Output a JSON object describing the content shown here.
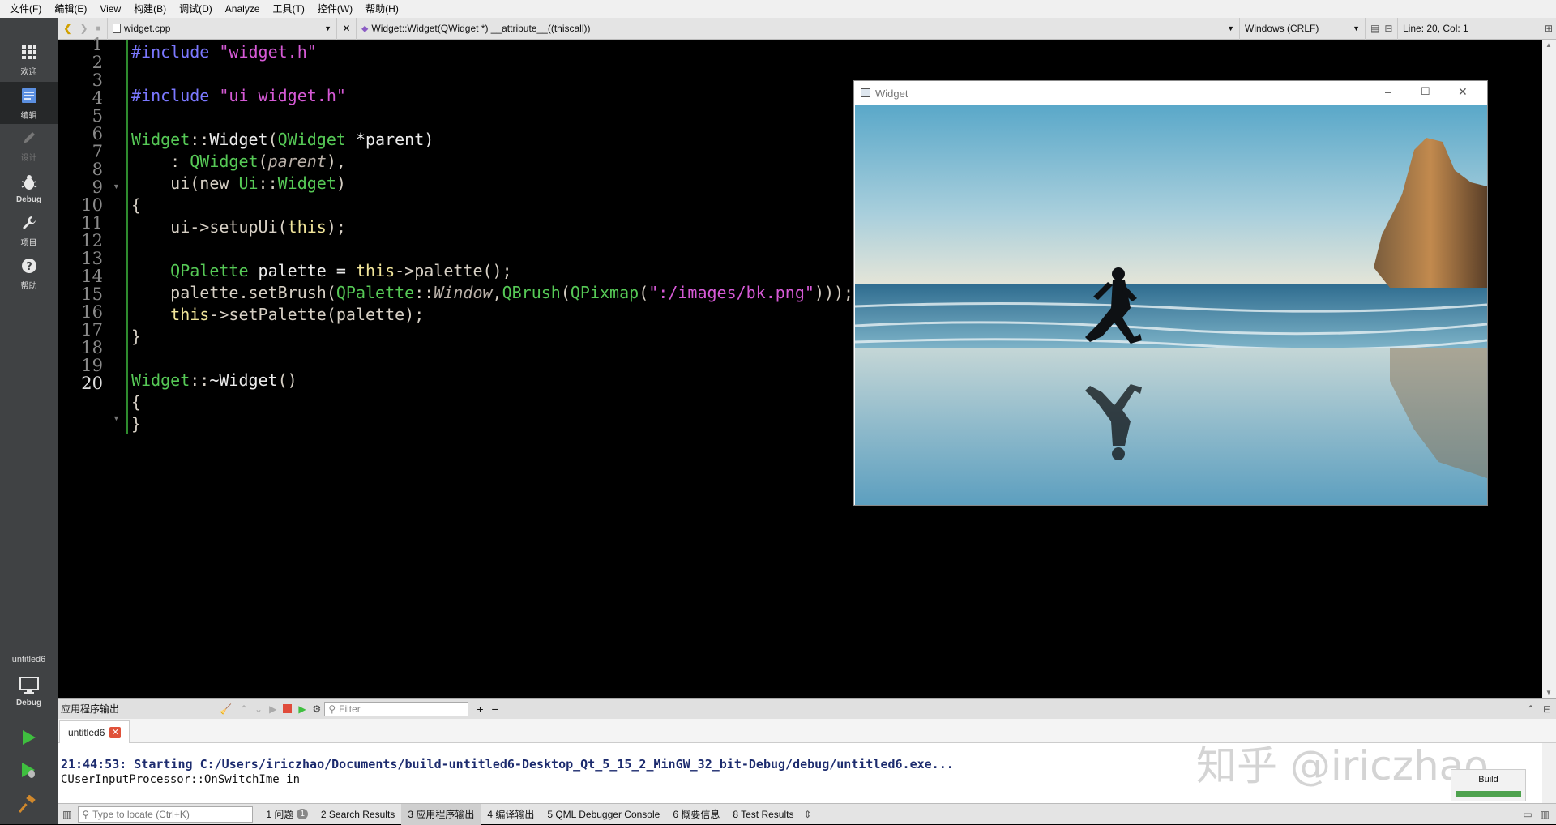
{
  "menu": [
    "文件(F)",
    "编辑(E)",
    "View",
    "构建(B)",
    "调试(D)",
    "Analyze",
    "工具(T)",
    "控件(W)",
    "帮助(H)"
  ],
  "modes": [
    {
      "label": "欢迎",
      "icon": "grid-icon"
    },
    {
      "label": "编辑",
      "icon": "edit-doc-icon"
    },
    {
      "label": "设计",
      "icon": "pencil-icon"
    },
    {
      "label": "Debug",
      "icon": "bug-icon"
    },
    {
      "label": "项目",
      "icon": "wrench-icon"
    },
    {
      "label": "帮助",
      "icon": "help-icon"
    }
  ],
  "kit": {
    "project": "untitled6",
    "config": "Debug"
  },
  "toolbar": {
    "file": "widget.cpp",
    "symbol": "Widget::Widget(QWidget *) __attribute__((thiscall))",
    "encoding": "Windows (CRLF)",
    "position": "Line: 20, Col: 1"
  },
  "line_numbers": [
    "1",
    "2",
    "3",
    "4",
    "5",
    "6",
    "7",
    "8",
    "9",
    "10",
    "11",
    "12",
    "13",
    "14",
    "15",
    "16",
    "17",
    "18",
    "19",
    "20"
  ],
  "current_line": "20",
  "code_tokens": [
    {
      "pp": "#include",
      "str": "\"widget.h\""
    },
    {
      "pp": "#include",
      "str": "\"ui_widget.h\""
    },
    {
      "cls": "Widget",
      "sep": "::",
      "fn": "Widget",
      "open": "(",
      "type": "QWidget",
      "rest": " *parent)"
    },
    {
      "pre": "    : ",
      "type": "QWidget",
      "open": "(",
      "it": "parent",
      "rest": "),"
    },
    {
      "pre": "    ui(new ",
      "ns": "Ui",
      "sep": "::",
      "type": "Widget",
      "rest": ")"
    },
    {
      "text": "{"
    },
    {
      "pre": "    ui->setupUi(",
      "kw": "this",
      "rest": ");"
    },
    {
      "pre": "    ",
      "type": "QPalette",
      "mid": " palette = ",
      "kw": "this",
      "rest": "->palette();"
    },
    {
      "pre": "    palette.setBrush(",
      "type": "QPalette",
      "sep": "::",
      "it": "Window",
      "comma": ",",
      "type2": "QBrush",
      "o2": "(",
      "type3": "QPixmap",
      "o3": "(",
      "str": "\":/images/bk.png\"",
      "rest": ")));"
    },
    {
      "pre": "    ",
      "kw": "this",
      "rest": "->setPalette(palette);"
    },
    {
      "text": "}"
    },
    {
      "cls": "Widget",
      "sep": "::",
      "fn": "~Widget",
      "rest": "()"
    },
    {
      "text": "{"
    },
    {
      "text": "}"
    }
  ],
  "widget_window": {
    "title": "Widget",
    "min": "–",
    "max": "☐",
    "close": "✕"
  },
  "output": {
    "title": "应用程序输出",
    "filter_placeholder": "Filter",
    "tab": "untitled6",
    "tab_close": "✕",
    "line1": "21:44:53: Starting C:/Users/iriczhao/Documents/build-untitled6-Desktop_Qt_5_15_2_MinGW_32_bit-Debug/debug/untitled6.exe...",
    "line2": "CUserInputProcessor::OnSwitchIme in"
  },
  "watermark": "知乎 @iriczhao",
  "build": {
    "label": "Build"
  },
  "status": {
    "locate_placeholder": "Type to locate (Ctrl+K)",
    "tabs": [
      {
        "label": "1 问题",
        "badge": "1"
      },
      {
        "label": "2 Search Results"
      },
      {
        "label": "3 应用程序输出"
      },
      {
        "label": "4 编译输出"
      },
      {
        "label": "5 QML Debugger Console"
      },
      {
        "label": "6 概要信息"
      },
      {
        "label": "8 Test Results"
      }
    ]
  },
  "colors": {
    "editor_bg": "#000000",
    "modebar_bg": "#404244",
    "output_text": "#1c2b6e",
    "build_bar": "#4ea24e"
  }
}
